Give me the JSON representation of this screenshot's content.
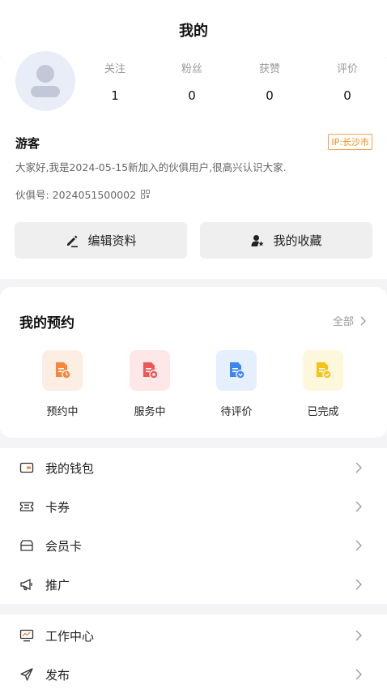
{
  "header": {
    "title": "我的"
  },
  "profile": {
    "stats": [
      {
        "label": "关注",
        "value": "1"
      },
      {
        "label": "粉丝",
        "value": "0"
      },
      {
        "label": "获赞",
        "value": "0"
      },
      {
        "label": "评价",
        "value": "0"
      }
    ],
    "username": "游客",
    "ip": "IP:长沙市",
    "bio": "大家好,我是2024-05-15新加入的伙俱用户,很高兴认识大家.",
    "partner_id": "伙俱号: 2024051500002",
    "edit_label": "编辑资料",
    "favorites_label": "我的收藏"
  },
  "booking": {
    "title": "我的预约",
    "all_label": "全部",
    "items": [
      {
        "label": "预约中",
        "color": "#f5873a",
        "bg": "#fdeee3"
      },
      {
        "label": "服务中",
        "color": "#f05656",
        "bg": "#fde7e7"
      },
      {
        "label": "待评价",
        "color": "#3b86f0",
        "bg": "#e5effd"
      },
      {
        "label": "已完成",
        "color": "#f4c21a",
        "bg": "#fdf7dc"
      }
    ]
  },
  "menu": {
    "group1": [
      {
        "label": "我的钱包",
        "icon": "wallet-icon"
      },
      {
        "label": "卡券",
        "icon": "coupon-icon"
      },
      {
        "label": "会员卡",
        "icon": "member-card-icon"
      },
      {
        "label": "推广",
        "icon": "megaphone-icon"
      }
    ],
    "group2": [
      {
        "label": "工作中心",
        "icon": "monitor-icon"
      },
      {
        "label": "发布",
        "icon": "send-icon"
      }
    ]
  },
  "colors": {
    "accent_orange": "#f08a1c",
    "icon_orange": "#f5873a",
    "text_gray": "#999999"
  }
}
